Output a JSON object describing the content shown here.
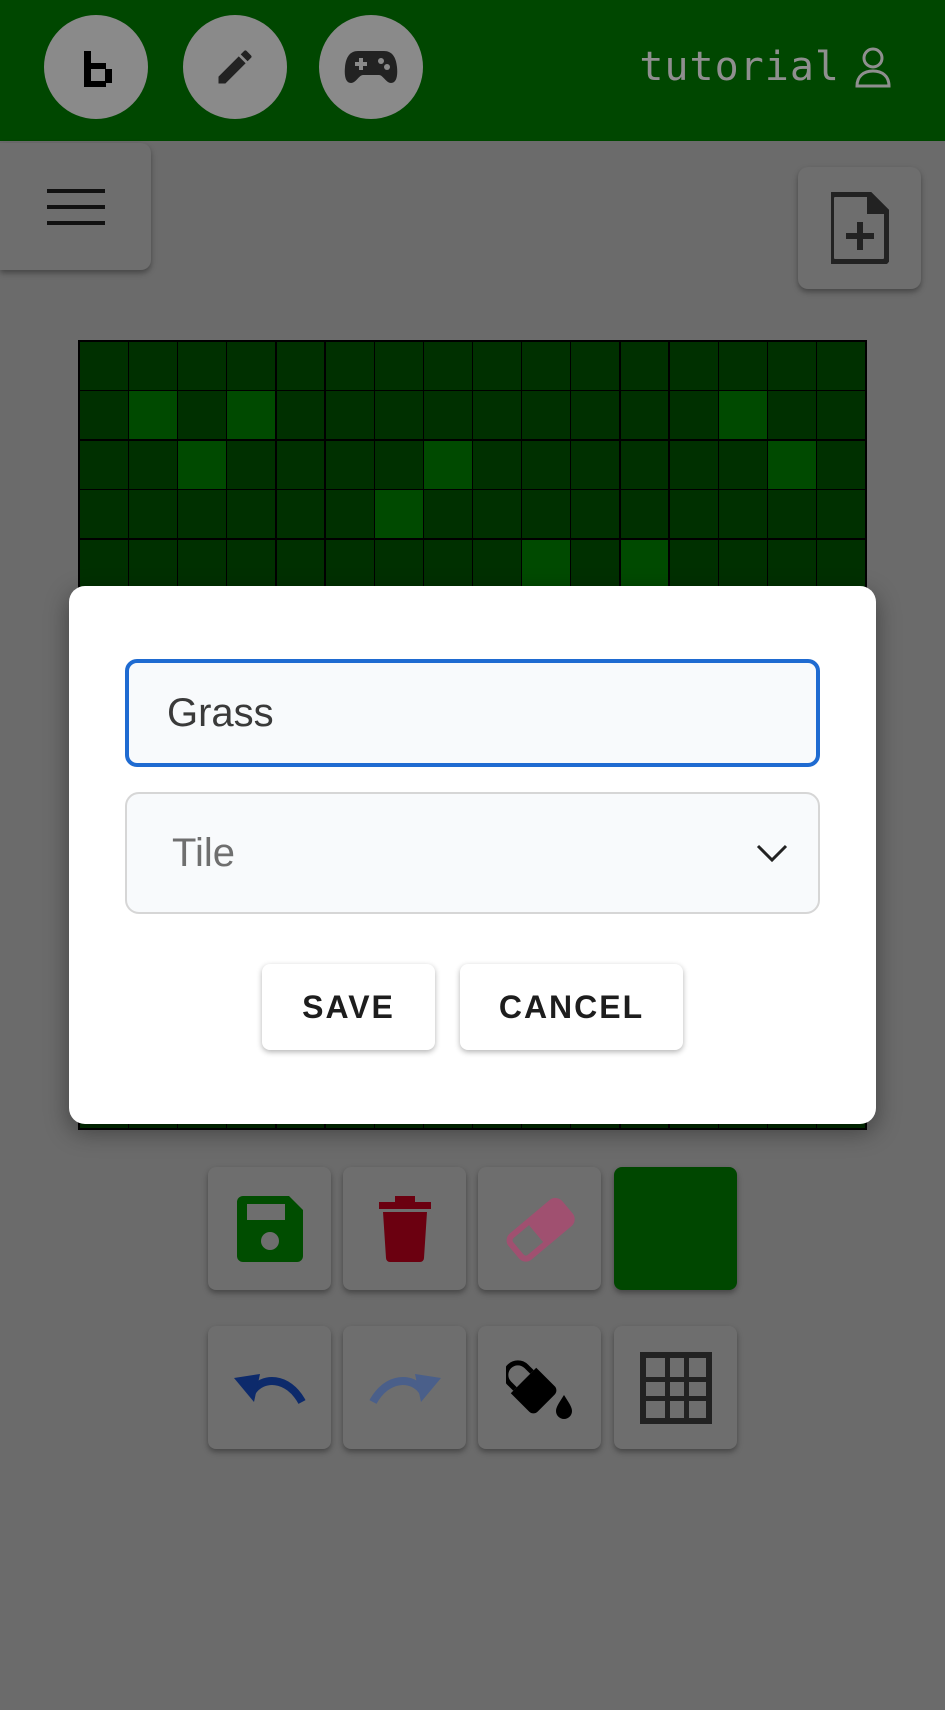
{
  "header": {
    "username": "tutorial",
    "nav": [
      {
        "icon": "logo-b-icon"
      },
      {
        "icon": "pencil-icon"
      },
      {
        "icon": "gamepad-icon"
      }
    ]
  },
  "toolbar_top": {
    "menu_icon": "hamburger-menu-icon",
    "new_file_icon": "new-file-plus-icon"
  },
  "canvas": {
    "columns": 16,
    "rows": 16,
    "base_color": "#003000",
    "highlight_color": "#004a00",
    "highlight_cells": [
      [
        1,
        1
      ],
      [
        1,
        3
      ],
      [
        1,
        13
      ],
      [
        2,
        2
      ],
      [
        2,
        7
      ],
      [
        2,
        14
      ],
      [
        3,
        6
      ],
      [
        4,
        9
      ],
      [
        4,
        11
      ]
    ]
  },
  "dialog": {
    "name_value": "Grass",
    "type_selected": "Tile",
    "save_label": "SAVE",
    "cancel_label": "CANCEL"
  },
  "tools": {
    "row1": [
      {
        "icon": "floppy-save-icon",
        "color": "#004d00"
      },
      {
        "icon": "trash-icon",
        "color": "#6b0010"
      },
      {
        "icon": "eraser-icon",
        "color": "#a05070"
      },
      {
        "icon": "current-color-swatch",
        "color": "#004700"
      }
    ],
    "row2": [
      {
        "icon": "undo-icon",
        "color": "#0d2a6b"
      },
      {
        "icon": "redo-icon",
        "color": "#4a5f8a"
      },
      {
        "icon": "paint-bucket-icon",
        "color": "#000000"
      },
      {
        "icon": "grid-icon",
        "color": "#222222"
      }
    ]
  }
}
